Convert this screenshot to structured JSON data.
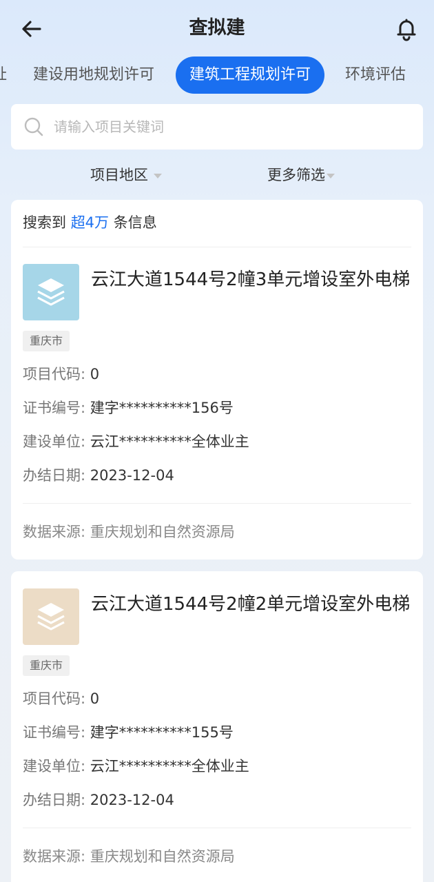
{
  "header": {
    "title": "查拟建"
  },
  "tabs": [
    {
      "label": "址"
    },
    {
      "label": "建设用地规划许可"
    },
    {
      "label": "建筑工程规划许可",
      "active": true
    },
    {
      "label": "环境评估"
    }
  ],
  "search": {
    "placeholder": "请输入项目关键词",
    "value": ""
  },
  "filters": [
    {
      "label": "项目地区"
    },
    {
      "label": "更多筛选"
    }
  ],
  "results": {
    "prefix": "搜索到",
    "count": "超4万",
    "suffix": "条信息"
  },
  "labels": {
    "code": "项目代码:",
    "cert": "证书编号:",
    "unit": "建设单位:",
    "date": "办结日期:",
    "source": "数据来源:"
  },
  "items": [
    {
      "title": "云江大道1544号2幢3单元增设室外电梯",
      "region": "重庆市",
      "code": "0",
      "cert": "建字**********156号",
      "unit": "云江**********全体业主",
      "date": "2023-12-04",
      "source": "重庆规划和自然资源局",
      "thumb_color": "#a6d6e8"
    },
    {
      "title": "云江大道1544号2幢2单元增设室外电梯",
      "region": "重庆市",
      "code": "0",
      "cert": "建字**********155号",
      "unit": "云江**********全体业主",
      "date": "2023-12-04",
      "source": "重庆规划和自然资源局",
      "thumb_color": "#ecdcc6"
    }
  ],
  "colors": {
    "accent": "#1a6ff0"
  }
}
